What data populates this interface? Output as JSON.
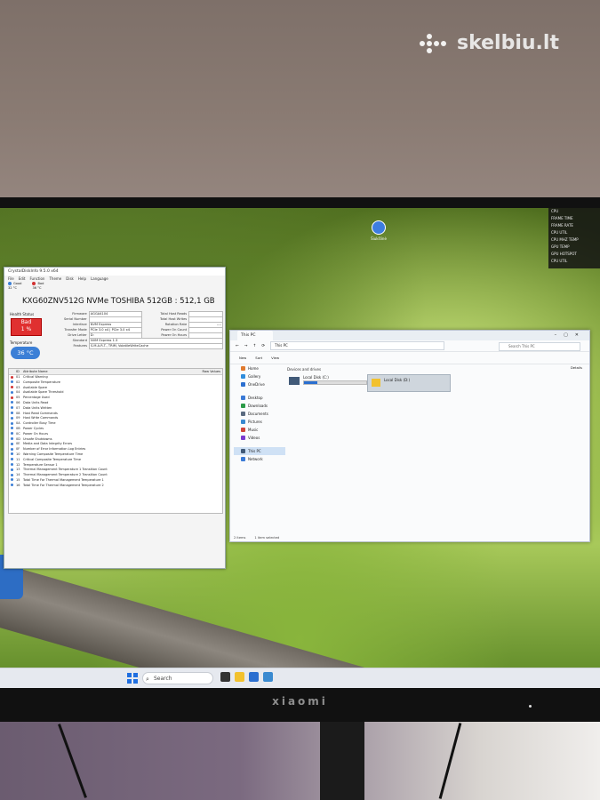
{
  "watermark": {
    "text": "skelbiu.lt"
  },
  "monitor": {
    "brand": "xiaomi"
  },
  "desktop_icon": {
    "label": "Šiukšlinė"
  },
  "overlay_rows": [
    {
      "k": "CPU",
      "v": ""
    },
    {
      "k": "FRAME TIME",
      "v": ""
    },
    {
      "k": "FRAME RATE",
      "v": ""
    },
    {
      "k": "CPU UTIL",
      "v": ""
    },
    {
      "k": "CPU MHZ TEMP",
      "v": ""
    },
    {
      "k": "GPU TEMP",
      "v": ""
    },
    {
      "k": "GPU HOTSPOT",
      "v": ""
    },
    {
      "k": "CPU UTIL",
      "v": ""
    }
  ],
  "crystaldisk": {
    "title": "CrystalDiskInfo 9.5.0 x64",
    "menu": [
      "File",
      "Edit",
      "Function",
      "Theme",
      "Disk",
      "Help",
      "Language"
    ],
    "disks": [
      {
        "status": "Good",
        "temp": "32 °C"
      },
      {
        "status": "Bad",
        "temp": "36 °C"
      }
    ],
    "model": "KXG60ZNV512G NVMe TOSHIBA 512GB : 512,1 GB",
    "health_label": "Health Status",
    "health_status": "Bad",
    "health_pct": "1 %",
    "temp_label": "Temperature",
    "temperature": "36 °C",
    "info_left": [
      {
        "k": "Firmware",
        "v": "AGGA4104"
      },
      {
        "k": "Serial Number",
        "v": ""
      },
      {
        "k": "Interface",
        "v": "NVM Express"
      },
      {
        "k": "Transfer Mode",
        "v": "PCIe 3.0 x4 | PCIe 3.0 x4"
      },
      {
        "k": "Drive Letter",
        "v": "D:"
      },
      {
        "k": "Standard",
        "v": "NVM Express 1.3"
      },
      {
        "k": "Features",
        "v": "S.M.A.R.T., TRIM, VolatileWriteCache"
      }
    ],
    "info_right": [
      {
        "k": "Total Host Reads",
        "v": ""
      },
      {
        "k": "Total Host Writes",
        "v": ""
      },
      {
        "k": "Rotation Rate",
        "v": "----"
      },
      {
        "k": "Power On Count",
        "v": ""
      },
      {
        "k": "Power On Hours",
        "v": ""
      }
    ],
    "smart_header": {
      "id": "ID",
      "name": "Attribute Name",
      "raw": "Raw Values"
    },
    "smart_rows": [
      {
        "id": "01",
        "name": "Critical Warning",
        "raw": "",
        "color": "#d23232"
      },
      {
        "id": "02",
        "name": "Composite Temperature",
        "raw": "",
        "color": "#3b7fd6"
      },
      {
        "id": "03",
        "name": "Available Spare",
        "raw": "",
        "color": "#d23232"
      },
      {
        "id": "04",
        "name": "Available Spare Threshold",
        "raw": "",
        "color": "#3b7fd6"
      },
      {
        "id": "05",
        "name": "Percentage Used",
        "raw": "",
        "color": "#d23232"
      },
      {
        "id": "06",
        "name": "Data Units Read",
        "raw": "",
        "color": "#3b7fd6"
      },
      {
        "id": "07",
        "name": "Data Units Written",
        "raw": "",
        "color": "#3b7fd6"
      },
      {
        "id": "08",
        "name": "Host Read Commands",
        "raw": "",
        "color": "#3b7fd6"
      },
      {
        "id": "09",
        "name": "Host Write Commands",
        "raw": "",
        "color": "#3b7fd6"
      },
      {
        "id": "0A",
        "name": "Controller Busy Time",
        "raw": "",
        "color": "#3b7fd6"
      },
      {
        "id": "0B",
        "name": "Power Cycles",
        "raw": "",
        "color": "#3b7fd6"
      },
      {
        "id": "0C",
        "name": "Power On Hours",
        "raw": "",
        "color": "#3b7fd6"
      },
      {
        "id": "0D",
        "name": "Unsafe Shutdowns",
        "raw": "",
        "color": "#3b7fd6"
      },
      {
        "id": "0E",
        "name": "Media and Data Integrity Errors",
        "raw": "",
        "color": "#3b7fd6"
      },
      {
        "id": "0F",
        "name": "Number of Error Information Log Entries",
        "raw": "",
        "color": "#3b7fd6"
      },
      {
        "id": "10",
        "name": "Warning Composite Temperature Time",
        "raw": "",
        "color": "#3b7fd6"
      },
      {
        "id": "11",
        "name": "Critical Composite Temperature Time",
        "raw": "",
        "color": "#3b7fd6"
      },
      {
        "id": "12",
        "name": "Temperature Sensor 1",
        "raw": "",
        "color": "#3b7fd6"
      },
      {
        "id": "13",
        "name": "Thermal Management Temperature 1 Transition Count",
        "raw": "",
        "color": "#3b7fd6"
      },
      {
        "id": "14",
        "name": "Thermal Management Temperature 2 Transition Count",
        "raw": "",
        "color": "#3b7fd6"
      },
      {
        "id": "15",
        "name": "Total Time For Thermal Management Temperature 1",
        "raw": "",
        "color": "#3b7fd6"
      },
      {
        "id": "16",
        "name": "Total Time For Thermal Management Temperature 2",
        "raw": "",
        "color": "#3b7fd6"
      }
    ]
  },
  "explorer": {
    "tab_title": "This PC",
    "address": "This PC",
    "search_placeholder": "Search This PC",
    "cmd_new": "New",
    "cmd_sort": "Sort",
    "cmd_view": "View",
    "cmd_details": "Details",
    "sidebar": [
      {
        "label": "Home",
        "color": "#e07a2e"
      },
      {
        "label": "Gallery",
        "color": "#2f8ddc"
      },
      {
        "label": "OneDrive",
        "color": "#2b6fd0"
      },
      {
        "label": "Desktop",
        "color": "#3a7ad6"
      },
      {
        "label": "Downloads",
        "color": "#2b9a48"
      },
      {
        "label": "Documents",
        "color": "#5a6b80"
      },
      {
        "label": "Pictures",
        "color": "#3a8ad0"
      },
      {
        "label": "Music",
        "color": "#d0463a"
      },
      {
        "label": "Videos",
        "color": "#7a3ad0"
      },
      {
        "label": "This PC",
        "color": "#415a78"
      },
      {
        "label": "Network",
        "color": "#3a7ad6"
      }
    ],
    "group_label": "Devices and drives",
    "drive_c": {
      "name": "Local Disk (C:)",
      "free": "",
      "used_fraction": 0.21
    },
    "drive_d": {
      "name": "Local Disk (D:)"
    },
    "status_items": "2 items",
    "status_selected": "1 item selected"
  },
  "taskbar": {
    "search_placeholder": "Search",
    "time": "",
    "date": ""
  }
}
